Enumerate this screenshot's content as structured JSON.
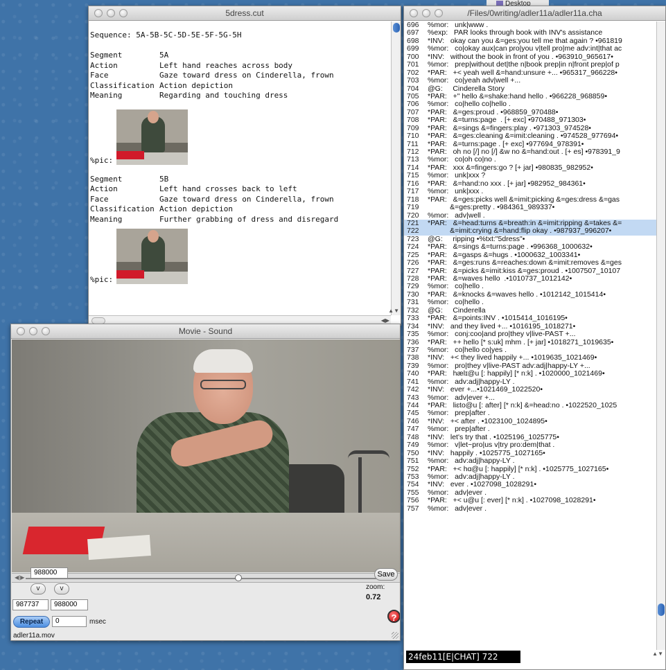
{
  "desktop": {
    "label": "Desktop"
  },
  "cut_window": {
    "title": "5dress.cut",
    "sequence": "Sequence: 5A-5B-5C-5D-5E-5F-5G-5H",
    "segments": [
      {
        "rows": [
          {
            "key": "Segment",
            "val": "5A"
          },
          {
            "key": "Action",
            "val": "Left hand reaches across body"
          },
          {
            "key": "Face",
            "val": "Gaze toward dress on Cinderella, frown"
          },
          {
            "key": "Classification",
            "val": "Action depiction"
          },
          {
            "key": "Meaning",
            "val": "Regarding and touching dress"
          }
        ],
        "pic_label": "%pic:"
      },
      {
        "rows": [
          {
            "key": "Segment",
            "val": "5B"
          },
          {
            "key": "Action",
            "val": "Left hand crosses back to left"
          },
          {
            "key": "Face",
            "val": "Gaze toward dress on Cinderella, frown"
          },
          {
            "key": "Classification",
            "val": "Action depiction"
          },
          {
            "key": "Meaning",
            "val": "Further grabbing of dress and disregard"
          }
        ],
        "pic_label": "%pic:"
      }
    ]
  },
  "movie_window": {
    "title": "Movie - Sound",
    "time_field": "988000",
    "v_label": "v",
    "save_label": "Save",
    "zoom_label": "zoom:",
    "zoom_value": "0.72",
    "start_field": "987737",
    "end_field": "988000",
    "repeat_label": "Repeat",
    "msec_value": "0",
    "msec_label": "msec",
    "filename": "adler11a.mov",
    "help_label": "?"
  },
  "chat_window": {
    "title": "/Files/0writing/adler11a/adler11a.cha",
    "status": "24feb11[E|CHAT]   722",
    "lines": [
      {
        "n": "696",
        "t": "%mor:   unk|www ."
      },
      {
        "n": "697",
        "t": "%exp:   PAR looks through book with INV's assistance"
      },
      {
        "n": "698",
        "t": "*INV:   okay can you &=ges:you tell me that again ? •961819"
      },
      {
        "n": "699",
        "t": "%mor:   co|okay aux|can pro|you v|tell pro|me adv:int|that ac"
      },
      {
        "n": "700",
        "t": "*INV:   without the book in front of you . •963910_965617•"
      },
      {
        "n": "701",
        "t": "%mor:   prep|without det|the n|book prep|in n|front prep|of p"
      },
      {
        "n": "702",
        "t": "*PAR:   +< yeah well &=hand:unsure +... •965317_966228•"
      },
      {
        "n": "703",
        "t": "%mor:   co|yeah adv|well +..."
      },
      {
        "n": "704",
        "t": "@G:     Cinderella Story"
      },
      {
        "n": "705",
        "t": "*PAR:   +\" hello &=shake:hand hello . •966228_968859•"
      },
      {
        "n": "706",
        "t": "%mor:   co|hello co|hello ."
      },
      {
        "n": "707",
        "t": "*PAR:   &=ges:proud . •968859_970488•"
      },
      {
        "n": "708",
        "t": "*PAR:   &=turns:page  . [+ exc] •970488_971303•"
      },
      {
        "n": "709",
        "t": "*PAR:   &=sings &=fingers:play . •971303_974528•"
      },
      {
        "n": "710",
        "t": "*PAR:   &=ges:cleaning &=imit:cleaning . •974528_977694•"
      },
      {
        "n": "711",
        "t": "*PAR:   &=turns:page . [+ exc] •977694_978391•"
      },
      {
        "n": "712",
        "t": "*PAR:   oh no [/] no [/] &w no &=hand:out . [+ es] •978391_9"
      },
      {
        "n": "713",
        "t": "%mor:   co|oh co|no ."
      },
      {
        "n": "714",
        "t": "*PAR:   xxx &=fingers:go ? [+ jar] •980835_982952•"
      },
      {
        "n": "715",
        "t": "%mor:   unk|xxx ?"
      },
      {
        "n": "716",
        "t": "*PAR:   &=hand:no xxx . [+ jar] •982952_984361•"
      },
      {
        "n": "717",
        "t": "%mor:   unk|xxx ."
      },
      {
        "n": "718",
        "t": "*PAR:   &=ges:picks well &=imit:picking &=ges:dress &=gas"
      },
      {
        "n": "719",
        "t": "           &=ges:pretty . •984361_989337•"
      },
      {
        "n": "720",
        "t": "%mor:   adv|well ."
      },
      {
        "n": "721",
        "t": "*PAR:   &=head:turns &=breath:in &=imit:ripping &=takes &=",
        "hl": true
      },
      {
        "n": "722",
        "t": "           &=imit:crying &=hand:flip okay . •987937_996207•",
        "hl": true
      },
      {
        "n": "723",
        "t": "@G:     ripping •%txt:\"5dress\"•"
      },
      {
        "n": "724",
        "t": "*PAR:   &=sings &=turns:page . •996368_1000632•"
      },
      {
        "n": "725",
        "t": "*PAR:   &=gasps &=hugs . •1000632_1003341•"
      },
      {
        "n": "726",
        "t": "*PAR:   &=ges:runs &=reaches:down &=imit:removes &=ges"
      },
      {
        "n": "727",
        "t": "*PAR:   &=picks &=imit:kiss &=ges:proud . •1007507_10107"
      },
      {
        "n": "728",
        "t": "*PAR:   &=waves hello  .•1010737_1012142•"
      },
      {
        "n": "729",
        "t": "%mor:   co|hello ."
      },
      {
        "n": "730",
        "t": "*PAR:   &=knocks &=waves hello . •1012142_1015414•"
      },
      {
        "n": "731",
        "t": "%mor:   co|hello ."
      },
      {
        "n": "732",
        "t": "@G:     Cinderella"
      },
      {
        "n": "733",
        "t": "*PAR:   &=points:INV . •1015414_1016195•"
      },
      {
        "n": "734",
        "t": "*INV:   and they lived +... •1016195_1018271•"
      },
      {
        "n": "735",
        "t": "%mor:   conj:coo|and pro|they v|live-PAST +..."
      },
      {
        "n": "736",
        "t": "*PAR:   ++ hello [* s:uk] mhm . [+ jar] •1018271_1019635•"
      },
      {
        "n": "737",
        "t": "%mor:   co|hello co|yes ."
      },
      {
        "n": "738",
        "t": "*INV:   +< they lived happily +... •1019635_1021469•"
      },
      {
        "n": "739",
        "t": "%mor:   pro|they v|live-PAST adv:adj|happy-LY +..."
      },
      {
        "n": "740",
        "t": "*PAR:   hælɪ@u [: happily] [* n:k] . •1020000_1021469•"
      },
      {
        "n": "741",
        "t": "%mor:   adv:adj|happy-LY ."
      },
      {
        "n": "742",
        "t": "*INV:   ever +...•1021469_1022520•"
      },
      {
        "n": "743",
        "t": "%mor:   adv|ever +..."
      },
      {
        "n": "744",
        "t": "*PAR:   liɛto@u [: after] [* n:k] &=head:no . •1022520_1025"
      },
      {
        "n": "745",
        "t": "%mor:   prep|after ."
      },
      {
        "n": "746",
        "t": "*INV:   +< after . •1023100_1024895•"
      },
      {
        "n": "747",
        "t": "%mor:   prep|after ."
      },
      {
        "n": "748",
        "t": "*INV:   let's try that . •1025196_1025775•"
      },
      {
        "n": "749",
        "t": "%mor:   v|let~pro|us v|try pro:dem|that ."
      },
      {
        "n": "750",
        "t": "*INV:   happily . •1025775_1027165•"
      },
      {
        "n": "751",
        "t": "%mor:   adv:adj|happy-LY ."
      },
      {
        "n": "752",
        "t": "*PAR:   +< hɑ@u [: happily] [* n:k] . •1025775_1027165•"
      },
      {
        "n": "753",
        "t": "%mor:   adv:adj|happy-LY ."
      },
      {
        "n": "754",
        "t": "*INV:   ever . •1027098_1028291•"
      },
      {
        "n": "755",
        "t": "%mor:   adv|ever ."
      },
      {
        "n": "756",
        "t": "*PAR:   +< u@u [: ever] [* n:k] . •1027098_1028291•"
      },
      {
        "n": "757",
        "t": "%mor:   adv|ever ."
      }
    ]
  }
}
